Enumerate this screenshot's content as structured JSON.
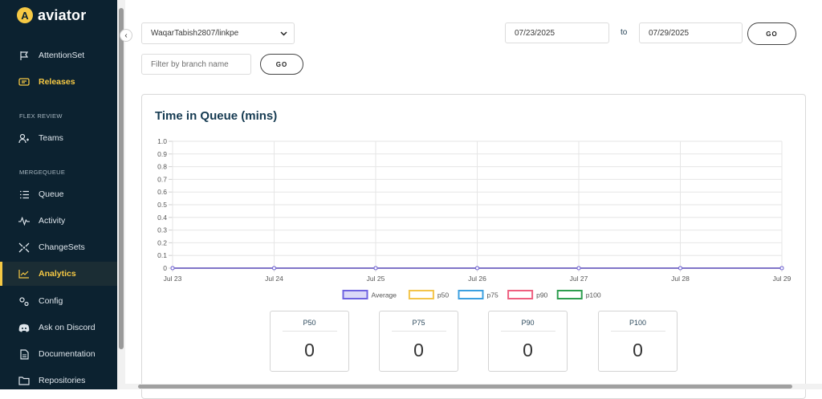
{
  "sidebar": {
    "brand": "aviator",
    "items": [
      {
        "label": "AttentionSet",
        "icon": "flag-icon"
      },
      {
        "label": "Releases",
        "icon": "release-icon"
      },
      {
        "label": "Teams",
        "icon": "teams-icon"
      },
      {
        "label": "Queue",
        "icon": "list-icon"
      },
      {
        "label": "Activity",
        "icon": "pulse-icon"
      },
      {
        "label": "ChangeSets",
        "icon": "changesets-icon"
      },
      {
        "label": "Analytics",
        "icon": "chart-line-icon"
      },
      {
        "label": "Config",
        "icon": "gears-icon"
      },
      {
        "label": "Ask on Discord",
        "icon": "discord-icon"
      },
      {
        "label": "Documentation",
        "icon": "document-icon"
      },
      {
        "label": "Repositories",
        "icon": "folder-icon"
      }
    ],
    "sections": {
      "flex_review": "FLEX REVIEW",
      "mergequeue": "MERGEQUEUE"
    }
  },
  "filters": {
    "repo_select": "WaqarTabish2807/linkpe",
    "branch_placeholder": "Filter by branch name",
    "go_label": "GO",
    "date_from": "07/23/2025",
    "date_to": "07/29/2025",
    "to_label": "to"
  },
  "chart_data": {
    "type": "line",
    "title": "Time in Queue (mins)",
    "x": [
      "Jul 23",
      "Jul 24",
      "Jul 25",
      "Jul 26",
      "Jul 27",
      "Jul 28",
      "Jul 29"
    ],
    "series": [
      {
        "name": "Average",
        "values": [
          0,
          0,
          0,
          0,
          0,
          0,
          0
        ],
        "color": "#6e62e0"
      },
      {
        "name": "p50",
        "values": [
          0,
          0,
          0,
          0,
          0,
          0,
          0
        ],
        "color": "#f3c44a"
      },
      {
        "name": "p75",
        "values": [
          0,
          0,
          0,
          0,
          0,
          0,
          0
        ],
        "color": "#3ca0e0"
      },
      {
        "name": "p90",
        "values": [
          0,
          0,
          0,
          0,
          0,
          0,
          0
        ],
        "color": "#ee5f7f"
      },
      {
        "name": "p100",
        "values": [
          0,
          0,
          0,
          0,
          0,
          0,
          0
        ],
        "color": "#2e9e4f"
      }
    ],
    "yticks": [
      "1.0",
      "0.9",
      "0.8",
      "0.7",
      "0.6",
      "0.5",
      "0.4",
      "0.3",
      "0.2",
      "0.1",
      "0"
    ],
    "ylim": [
      0,
      1
    ],
    "grid": true,
    "legend": "bottom"
  },
  "stats": [
    {
      "label": "P50",
      "value": "0"
    },
    {
      "label": "P75",
      "value": "0"
    },
    {
      "label": "P90",
      "value": "0"
    },
    {
      "label": "P100",
      "value": "0"
    }
  ]
}
